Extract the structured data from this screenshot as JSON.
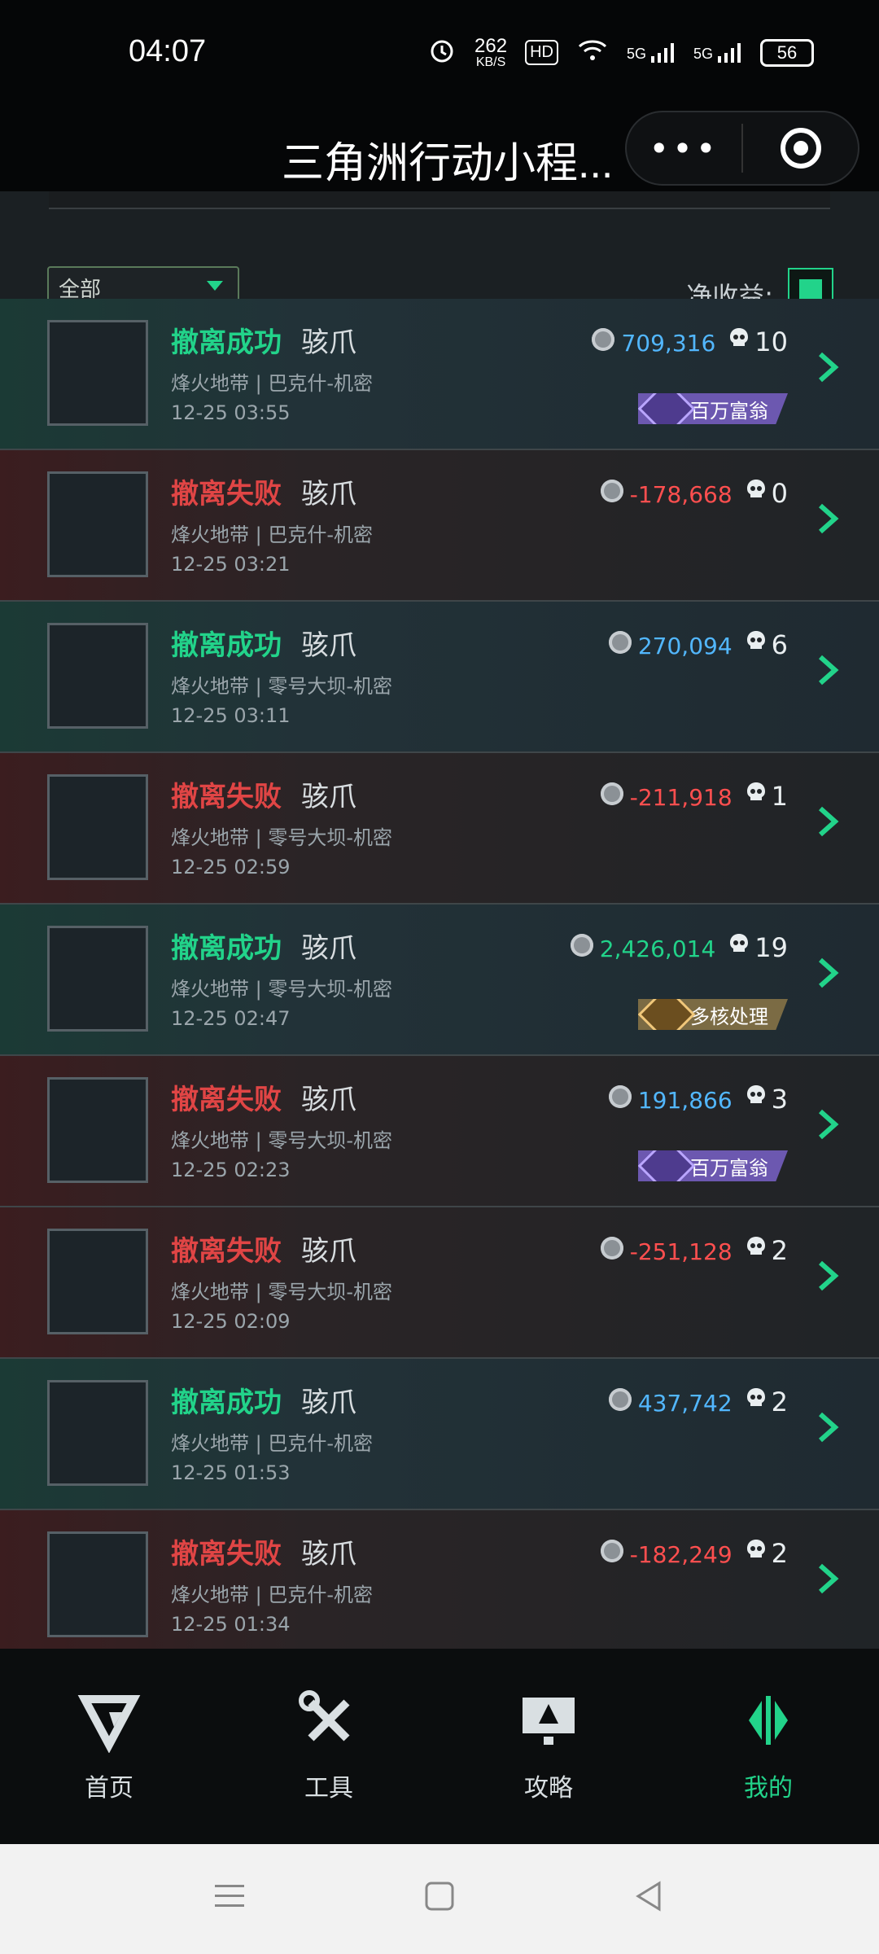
{
  "status_bar": {
    "time": "04:07",
    "net_speed_value": "262",
    "net_speed_unit": "KB/S",
    "hd_label": "HD",
    "sig1": "5G",
    "sig2": "5G",
    "battery": "56"
  },
  "mini_app": {
    "title": "三角洲行动小程...",
    "more_icon": "more-dots-icon",
    "close_icon": "target-icon"
  },
  "filter": {
    "selected": "全部",
    "net_label": "净收益:"
  },
  "rows": [
    {
      "status": "撤离成功",
      "type": "success",
      "operator": "骇爪",
      "map": "烽火地带 | 巴克什-机密",
      "time": "12-25 03:55",
      "money": "709,316",
      "money_class": "pos",
      "kills": "10",
      "badge": "百万富翁",
      "badge_type": "purple"
    },
    {
      "status": "撤离失败",
      "type": "fail",
      "operator": "骇爪",
      "map": "烽火地带 | 巴克什-机密",
      "time": "12-25 03:21",
      "money": "-178,668",
      "money_class": "neg",
      "kills": "0",
      "badge": "",
      "badge_type": ""
    },
    {
      "status": "撤离成功",
      "type": "success",
      "operator": "骇爪",
      "map": "烽火地带 | 零号大坝-机密",
      "time": "12-25 03:11",
      "money": "270,094",
      "money_class": "pos",
      "kills": "6",
      "badge": "",
      "badge_type": ""
    },
    {
      "status": "撤离失败",
      "type": "fail",
      "operator": "骇爪",
      "map": "烽火地带 | 零号大坝-机密",
      "time": "12-25 02:59",
      "money": "-211,918",
      "money_class": "neg",
      "kills": "1",
      "badge": "",
      "badge_type": ""
    },
    {
      "status": "撤离成功",
      "type": "success",
      "operator": "骇爪",
      "map": "烽火地带 | 零号大坝-机密",
      "time": "12-25 02:47",
      "money": "2,426,014",
      "money_class": "green",
      "kills": "19",
      "badge": "多核处理",
      "badge_type": "gold"
    },
    {
      "status": "撤离失败",
      "type": "fail",
      "operator": "骇爪",
      "map": "烽火地带 | 零号大坝-机密",
      "time": "12-25 02:23",
      "money": "191,866",
      "money_class": "pos",
      "kills": "3",
      "badge": "百万富翁",
      "badge_type": "purple"
    },
    {
      "status": "撤离失败",
      "type": "fail",
      "operator": "骇爪",
      "map": "烽火地带 | 零号大坝-机密",
      "time": "12-25 02:09",
      "money": "-251,128",
      "money_class": "neg",
      "kills": "2",
      "badge": "",
      "badge_type": ""
    },
    {
      "status": "撤离成功",
      "type": "success",
      "operator": "骇爪",
      "map": "烽火地带 | 巴克什-机密",
      "time": "12-25 01:53",
      "money": "437,742",
      "money_class": "pos",
      "kills": "2",
      "badge": "",
      "badge_type": ""
    },
    {
      "status": "撤离失败",
      "type": "fail",
      "operator": "骇爪",
      "map": "烽火地带 | 巴克什-机密",
      "time": "12-25 01:34",
      "money": "-182,249",
      "money_class": "neg",
      "kills": "2",
      "badge": "",
      "badge_type": ""
    }
  ],
  "bottom_nav": [
    {
      "label": "首页",
      "icon": "home-logo-icon",
      "active": false
    },
    {
      "label": "工具",
      "icon": "tools-icon",
      "active": false
    },
    {
      "label": "攻略",
      "icon": "guide-icon",
      "active": false
    },
    {
      "label": "我的",
      "icon": "profile-logo-icon",
      "active": true
    }
  ],
  "system_nav": {
    "menu_icon": "menu-icon",
    "home_icon": "home-square-icon",
    "back_icon": "back-triangle-icon"
  },
  "colors": {
    "accent": "#22d38a",
    "fail": "#e04545",
    "money_pos": "#52b7ff",
    "money_neg": "#ff4f4f"
  }
}
